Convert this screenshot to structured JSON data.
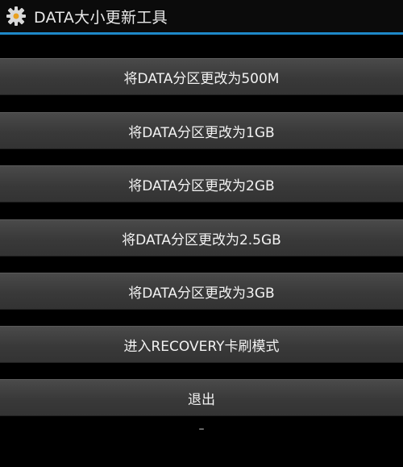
{
  "header": {
    "title": "DATA大小更新工具",
    "icon": "gear-icon"
  },
  "buttons": [
    {
      "label": "将DATA分区更改为500M"
    },
    {
      "label": "将DATA分区更改为1GB"
    },
    {
      "label": "将DATA分区更改为2GB"
    },
    {
      "label": "将DATA分区更改为2.5GB"
    },
    {
      "label": "将DATA分区更改为3GB"
    },
    {
      "label": "进入RECOVERY卡刷模式"
    },
    {
      "label": "退出"
    }
  ],
  "footer": {
    "text": "–"
  },
  "colors": {
    "accent": "#1e88c8",
    "warning_text": "#d81e1e",
    "background": "#000000",
    "button": "#3a3a3a"
  }
}
